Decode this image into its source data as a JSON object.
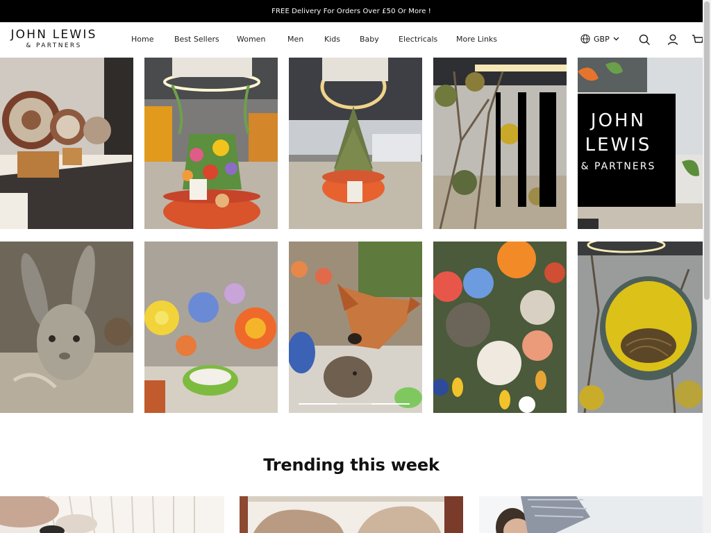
{
  "announcement": "FREE Delivery For Orders Over £50 Or More !",
  "brand": {
    "name": "JOHN LEWIS",
    "sub": "& PARTNERS"
  },
  "nav": [
    {
      "label": "Home"
    },
    {
      "label": "Best Sellers"
    },
    {
      "label": "Women"
    },
    {
      "label": "Men"
    },
    {
      "label": "Kids"
    },
    {
      "label": "Baby"
    },
    {
      "label": "Electricals"
    },
    {
      "label": "More Links"
    }
  ],
  "currency": "GBP",
  "icons": {
    "globe": "globe-icon",
    "chevron": "chevron-down-icon",
    "search": "search-icon",
    "account": "account-icon",
    "cart": "cart-icon"
  },
  "gallery_tiles": [
    "ceramic plates on shelf",
    "flower display under ring light",
    "tree display under ring light",
    "branches with brand sign",
    "window with leaves",
    "hare sculpture",
    "paper flowers",
    "fox and hedgehog figures",
    "pom-pom flowers and bees",
    "nest in yellow pot"
  ],
  "brand_sign": {
    "line1": "JOHN",
    "line2": "LEWIS",
    "line3": "& PARTNERS"
  },
  "section_title": "Trending this week",
  "colors": {
    "topbar": "#000000",
    "text": "#111111",
    "accent_orange": "#d9532b"
  }
}
